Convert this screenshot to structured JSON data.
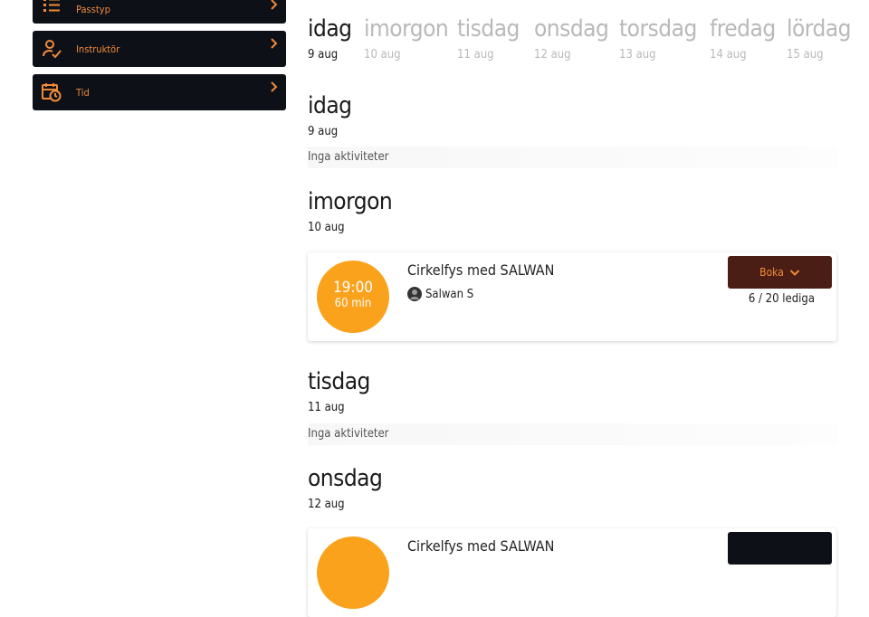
{
  "filters": [
    {
      "label": "Passtyp",
      "icon": "list-icon"
    },
    {
      "label": "Instruktör",
      "icon": "user-check-icon"
    },
    {
      "label": "Tid",
      "icon": "calendar-clock-icon"
    }
  ],
  "tabs": [
    {
      "name": "idag",
      "date": "9 aug",
      "active": true
    },
    {
      "name": "imorgon",
      "date": "10 aug",
      "active": false
    },
    {
      "name": "tisdag",
      "date": "11 aug",
      "active": false
    },
    {
      "name": "onsdag",
      "date": "12 aug",
      "active": false
    },
    {
      "name": "torsdag",
      "date": "13 aug",
      "active": false
    },
    {
      "name": "fredag",
      "date": "14 aug",
      "active": false
    },
    {
      "name": "lördag",
      "date": "15 aug",
      "active": false
    }
  ],
  "days": [
    {
      "title": "idag",
      "date": "9 aug",
      "empty": "Inga aktiviteter"
    },
    {
      "title": "imorgon",
      "date": "10 aug",
      "activity": {
        "time": "19:00",
        "duration": "60 min",
        "title": "Cirkelfys med SALWAN",
        "instructor": "Salwan S",
        "book_label": "Boka",
        "slots": "6 / 20 lediga"
      }
    },
    {
      "title": "tisdag",
      "date": "11 aug",
      "empty": "Inga aktiviteter"
    },
    {
      "title": "onsdag",
      "date": "12 aug",
      "activity": {
        "title": "Cirkelfys med SALWAN"
      }
    }
  ],
  "colors": {
    "accent": "#f08a3a",
    "time_circle": "#fba21c",
    "dark": "#0d1117",
    "book_button": "#4a1e14"
  }
}
